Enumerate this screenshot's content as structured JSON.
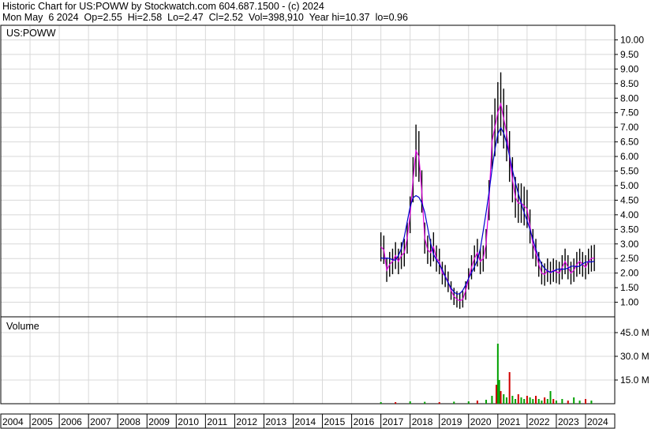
{
  "header": {
    "line1": "Historic Chart for US:POWW by Stockwatch.com 604.687.1500 - (c) 2024",
    "line2": "Mon May  6 2024  Op=2.55  Hi=2.58  Lo=2.47  Cl=2.52  Vol=398,910  Year hi=10.37  lo=0.96"
  },
  "colors": {
    "price_bar": "#000000",
    "ma_short": "#e000e0",
    "ma_long": "#0000cc",
    "vol_up": "#00a000",
    "vol_down": "#d00000",
    "grid": "#d8d8d8"
  },
  "chart_data": [
    {
      "type": "line",
      "title": "US:POWW",
      "y_ticks": [
        "10.00",
        "9.50",
        "9.00",
        "8.50",
        "8.00",
        "7.50",
        "7.00",
        "6.50",
        "6.00",
        "5.50",
        "5.00",
        "4.50",
        "4.00",
        "3.50",
        "3.00",
        "2.50",
        "2.00",
        "1.50",
        "1.00"
      ],
      "ylim": [
        0.5,
        10.5
      ],
      "series": [
        {
          "x": [
            2017.0,
            2017.1,
            2017.2,
            2017.3,
            2017.4,
            2017.5,
            2017.6,
            2017.7,
            2017.8,
            2017.9,
            2018.0,
            2018.1,
            2018.2,
            2018.3,
            2018.4,
            2018.5,
            2018.6,
            2018.7,
            2018.8,
            2018.9,
            2019.0,
            2019.1,
            2019.2,
            2019.3,
            2019.4,
            2019.5,
            2019.6,
            2019.7,
            2019.8,
            2019.9,
            2020.0,
            2020.1,
            2020.2,
            2020.3,
            2020.4,
            2020.5,
            2020.6,
            2020.7,
            2020.8,
            2020.9,
            2021.0,
            2021.1,
            2021.2,
            2021.3,
            2021.4,
            2021.5,
            2021.6,
            2021.7,
            2021.8,
            2021.9,
            2022.0,
            2022.1,
            2022.2,
            2022.3,
            2022.4,
            2022.5,
            2022.6,
            2022.7,
            2022.8,
            2022.9,
            2023.0,
            2023.1,
            2023.2,
            2023.3,
            2023.4,
            2023.5,
            2023.6,
            2023.7,
            2023.8,
            2023.9,
            2024.0,
            2024.1,
            2024.2,
            2024.3
          ],
          "y": [
            2.9,
            2.8,
            2.1,
            2.3,
            2.4,
            2.6,
            2.4,
            2.6,
            2.7,
            3.2,
            4.0,
            5.2,
            6.2,
            6.0,
            4.8,
            3.2,
            2.8,
            2.7,
            2.9,
            2.5,
            2.4,
            2.0,
            1.9,
            1.7,
            1.4,
            1.2,
            1.1,
            1.05,
            1.1,
            1.4,
            1.8,
            2.2,
            2.5,
            2.7,
            2.4,
            2.5,
            3.0,
            4.5,
            6.5,
            7.0,
            7.5,
            7.8,
            7.3,
            6.8,
            6.0,
            5.2,
            4.6,
            4.4,
            4.4,
            4.3,
            4.2,
            3.6,
            3.0,
            2.7,
            2.3,
            2.0,
            1.95,
            2.1,
            2.0,
            2.1,
            2.05,
            2.0,
            2.2,
            2.4,
            2.2,
            2.0,
            2.1,
            2.3,
            2.4,
            2.3,
            2.2,
            2.4,
            2.5,
            2.52
          ]
        }
      ]
    },
    {
      "type": "bar",
      "title": "Volume",
      "y_ticks": [
        "45.0 M",
        "30.0 M",
        "15.0 M"
      ],
      "ylim": [
        0,
        55
      ],
      "x": [
        2017.0,
        2017.5,
        2018.0,
        2018.5,
        2019.0,
        2019.5,
        2020.0,
        2020.3,
        2020.6,
        2020.8,
        2020.95,
        2021.0,
        2021.05,
        2021.1,
        2021.2,
        2021.3,
        2021.4,
        2021.5,
        2021.6,
        2021.7,
        2021.8,
        2021.9,
        2022.0,
        2022.1,
        2022.2,
        2022.3,
        2022.4,
        2022.5,
        2022.6,
        2022.7,
        2022.8,
        2022.9,
        2023.0,
        2023.2,
        2023.4,
        2023.6,
        2023.8,
        2024.0,
        2024.2
      ],
      "values": [
        1.0,
        1.0,
        1.5,
        1.2,
        1.0,
        1.3,
        1.5,
        2.0,
        2.5,
        5.0,
        12.0,
        38.0,
        15.0,
        8.0,
        6.0,
        4.0,
        20.0,
        5.0,
        3.0,
        6.0,
        4.0,
        3.0,
        5.0,
        4.0,
        3.0,
        5.0,
        3.0,
        2.0,
        4.0,
        3.0,
        8.0,
        3.0,
        2.0,
        3.0,
        2.0,
        4.0,
        2.0,
        3.0,
        2.0
      ]
    }
  ],
  "x_axis": {
    "ticks": [
      "2004",
      "2005",
      "2006",
      "2007",
      "2008",
      "2009",
      "2010",
      "2011",
      "2012",
      "2013",
      "2014",
      "2015",
      "2016",
      "2017",
      "2018",
      "2019",
      "2020",
      "2021",
      "2022",
      "2023",
      "2024"
    ]
  }
}
